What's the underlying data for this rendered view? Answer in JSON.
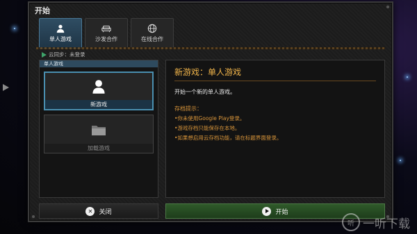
{
  "window": {
    "title": "开始"
  },
  "tabs": [
    {
      "label": "单人游戏",
      "icon": "person-icon",
      "active": true
    },
    {
      "label": "沙发合作",
      "icon": "sofa-icon",
      "active": false
    },
    {
      "label": "在线合作",
      "icon": "globe-icon",
      "active": false
    }
  ],
  "sync_status": "云同步：未登录",
  "left_panel": {
    "header": "单人游戏",
    "slots": [
      {
        "label": "新游戏",
        "icon": "person-icon"
      },
      {
        "label": "加载游戏",
        "icon": "folder-icon"
      }
    ]
  },
  "details": {
    "title": "新游戏：单人游戏",
    "description": "开始一个新的单人游戏。",
    "tips_header": "存档提示：",
    "tips": [
      "•你未使用Google Play登录。",
      "•游戏存档只能保存在本地。",
      "•如果想启用云存档功能，请在标题界面登录。"
    ]
  },
  "buttons": {
    "close": "关闭",
    "start": "开始"
  },
  "watermark": "一听下载",
  "colors": {
    "accent": "#f0b44a",
    "tab_active": "#2f4d63",
    "start_button": "#2f5a2a"
  }
}
